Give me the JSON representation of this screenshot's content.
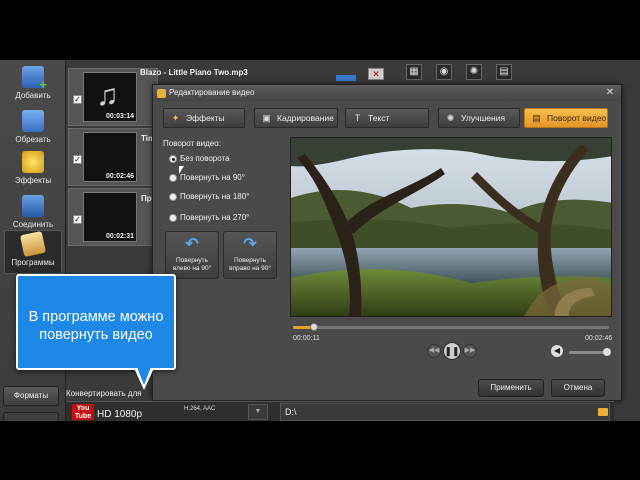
{
  "left_toolbar": {
    "items": [
      {
        "label": "Добавить",
        "icon": "add-video-icon"
      },
      {
        "label": "Обрезать",
        "icon": "cut-icon"
      },
      {
        "label": "Эффекты",
        "icon": "effects-icon"
      },
      {
        "label": "Соединить",
        "icon": "join-icon"
      },
      {
        "label": "Программы",
        "icon": "programs-icon"
      }
    ],
    "formats_label": "Форматы"
  },
  "files": [
    {
      "name": "Blazo - Little Piano Two.mp3",
      "duration": "00:03:14"
    },
    {
      "name": "Tim",
      "duration": "00:02:46"
    },
    {
      "name": "Пр",
      "duration": "00:02:31"
    }
  ],
  "dialog": {
    "title": "Редактирование видео",
    "tabs": [
      {
        "label": "Эффекты",
        "icon": "effects-icon"
      },
      {
        "label": "Кадрирование",
        "icon": "crop-icon"
      },
      {
        "label": "Текст",
        "icon": "text-icon"
      },
      {
        "label": "Улучшения",
        "icon": "enhance-icon"
      },
      {
        "label": "Поворот видео",
        "icon": "rotate-icon"
      }
    ],
    "rotation_label": "Поворот видео:",
    "rotation_options": [
      "Без поворота",
      "Повернуть на 90°",
      "Повернуть на 180°",
      "Повернуть на 270°"
    ],
    "rotate_left": [
      "Повернуть",
      "влево  на 90°"
    ],
    "rotate_right": [
      "Повернуть",
      "вправо на 90°"
    ],
    "time_current": "00:00:11",
    "time_total": "00:02:46",
    "progress_fraction": 0.066,
    "volume_fraction": 0.95,
    "apply_label": "Применить",
    "cancel_label": "Отмена"
  },
  "convert": {
    "label": "Конвертировать для",
    "logo_top": "You",
    "logo_bottom": "Tube",
    "format": "HD 1080p",
    "codec": "H.264, AAC",
    "path": "D:\\"
  },
  "annotation": {
    "line1": "В программе можно",
    "line2": "повернуть видео",
    "color": "#1e88e6"
  }
}
